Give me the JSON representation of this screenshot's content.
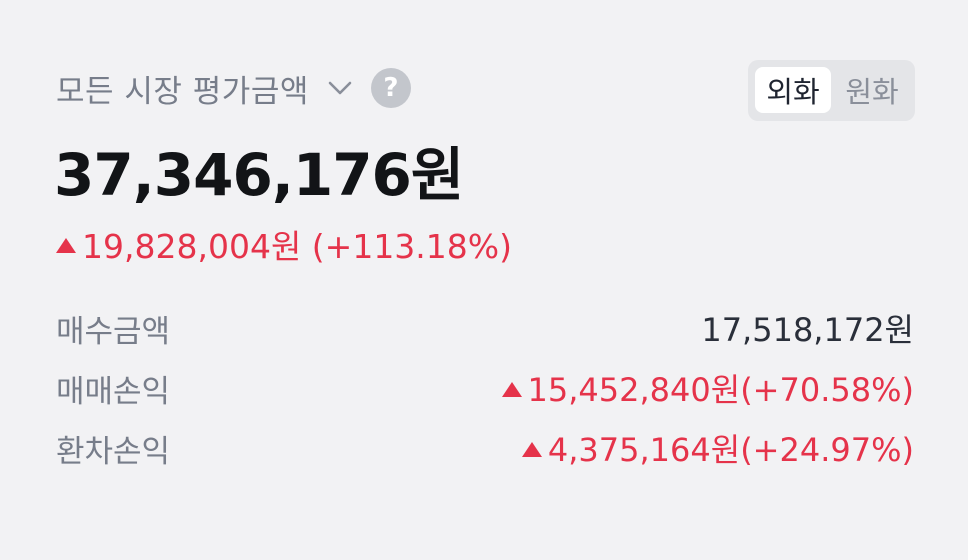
{
  "header": {
    "title": "모든 시장 평가금액",
    "help_symbol": "?",
    "chevron_icon": "chevron-down-icon"
  },
  "currency_toggle": {
    "options": [
      "외화",
      "원화"
    ],
    "selected": "외화"
  },
  "total": {
    "value": "37,346,176원"
  },
  "change": {
    "text": "19,828,004원 (+113.18%)",
    "direction": "up",
    "color": "#e5334a"
  },
  "rows": [
    {
      "label": "매수금액",
      "value": "17,518,172원",
      "direction": null
    },
    {
      "label": "매매손익",
      "value": "15,452,840원(+70.58%)",
      "direction": "up"
    },
    {
      "label": "환차손익",
      "value": "4,375,164원(+24.97%)",
      "direction": "up"
    }
  ]
}
